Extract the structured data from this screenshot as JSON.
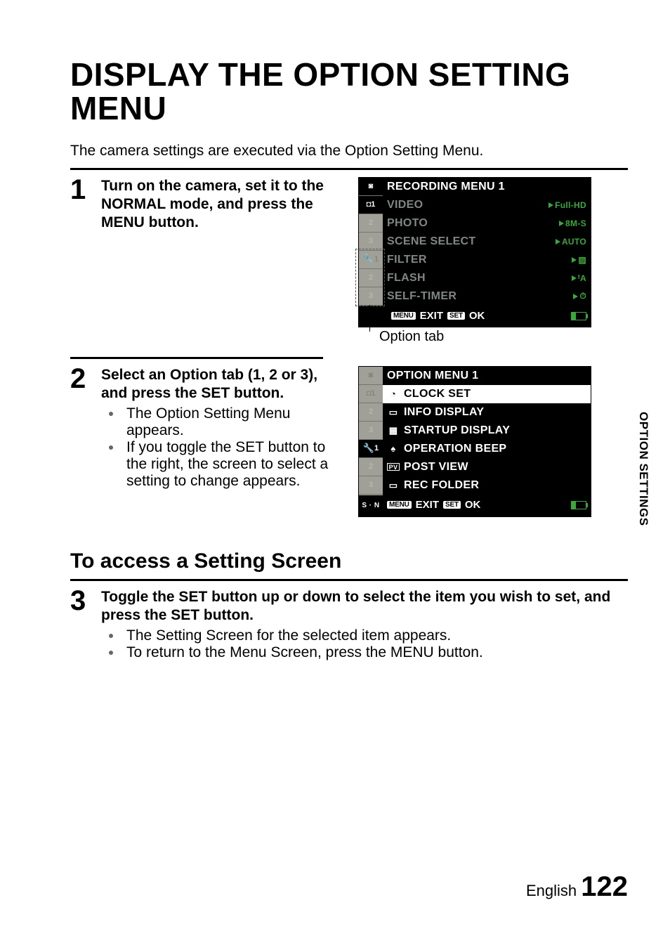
{
  "title": "DISPLAY THE OPTION SETTING MENU",
  "intro": "The camera settings are executed via the Option Setting Menu.",
  "side_label": "OPTION SETTINGS",
  "footer": {
    "lang": "English",
    "page": "122"
  },
  "subheading": "To access a Setting Screen",
  "callout1": "Option tab",
  "steps": [
    {
      "num": "1",
      "lead": "Turn on the camera, set it to the NORMAL mode, and press the MENU button."
    },
    {
      "num": "2",
      "lead": "Select an Option tab (1, 2 or 3), and press the SET button.",
      "bullets": [
        "The Option Setting Menu appears.",
        "If you toggle the SET button to the right, the screen to select a setting to change appears."
      ]
    },
    {
      "num": "3",
      "lead": "Toggle the SET button up or down to select the item you wish to set, and press the SET button.",
      "bullets": [
        "The Setting Screen for the selected item appears.",
        "To return to the Menu Screen, press the MENU button."
      ]
    }
  ],
  "lcd1": {
    "title": "RECORDING MENU 1",
    "tabs_top": [
      "1",
      "2",
      "3"
    ],
    "tabs_bottom": [
      "1",
      "2",
      "3"
    ],
    "rows": [
      {
        "label": "VIDEO",
        "right": "Full-HD"
      },
      {
        "label": "PHOTO",
        "right": "8M-S"
      },
      {
        "label": "SCENE SELECT",
        "right": "AUTO"
      },
      {
        "label": "FILTER",
        "right": ""
      },
      {
        "label": "FLASH",
        "right": "ᶠA"
      },
      {
        "label": "SELF-TIMER",
        "right": ""
      }
    ],
    "foot": {
      "menu_pill": "MENU",
      "exit": "EXIT",
      "set_pill": "SET",
      "ok": "OK"
    }
  },
  "lcd2": {
    "title": "OPTION MENU 1",
    "tabs_top": [
      "1",
      "2",
      "3"
    ],
    "tabs_bottom": [
      "1",
      "2",
      "3"
    ],
    "sn": "S · N",
    "rows": [
      {
        "icon": "◔",
        "label": "CLOCK SET",
        "active": true
      },
      {
        "icon": "▭",
        "label": "INFO DISPLAY"
      },
      {
        "icon": "▦",
        "label": "STARTUP DISPLAY"
      },
      {
        "icon": "♠",
        "label": "OPERATION BEEP"
      },
      {
        "icon": "PV",
        "label": "POST VIEW"
      },
      {
        "icon": "▭",
        "label": "REC FOLDER"
      }
    ],
    "foot": {
      "menu_pill": "MENU",
      "exit": "EXIT",
      "set_pill": "SET",
      "ok": "OK"
    }
  }
}
